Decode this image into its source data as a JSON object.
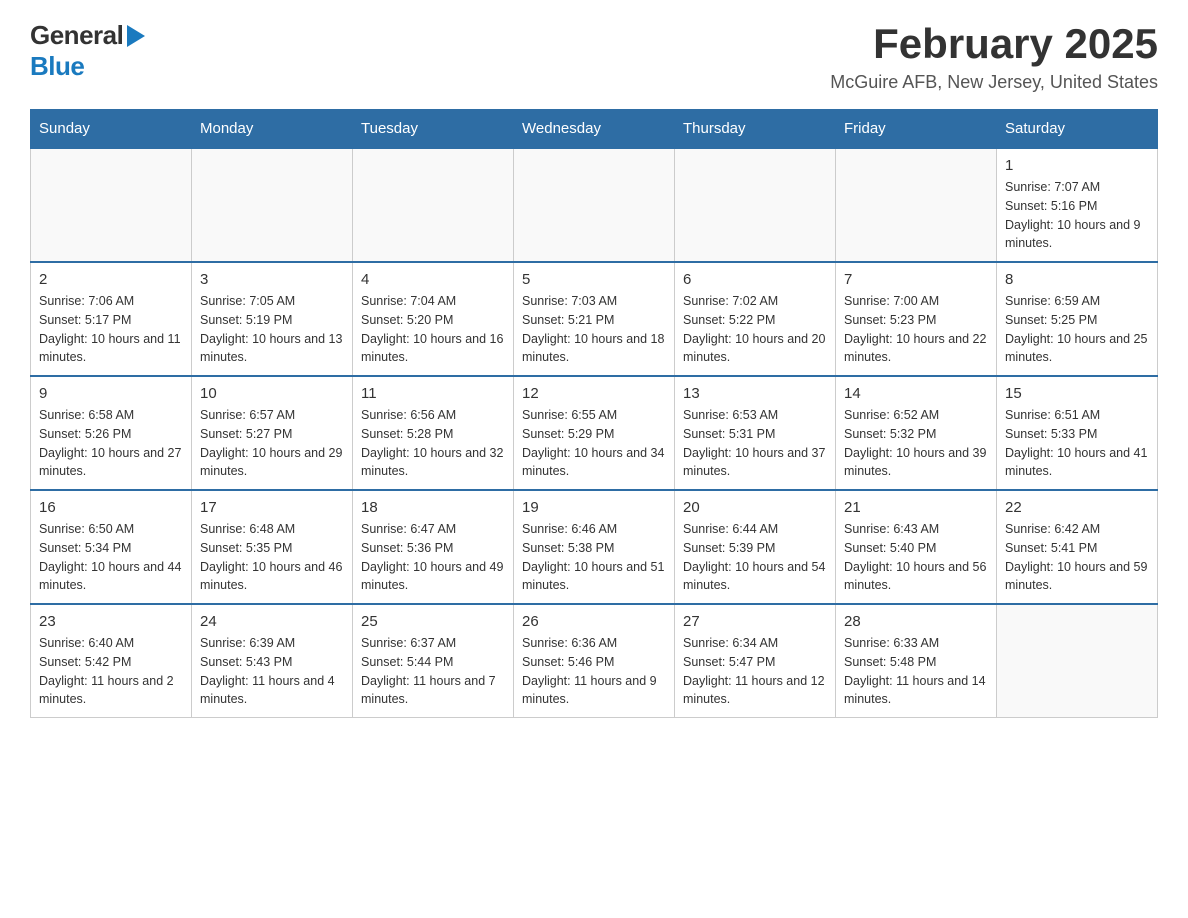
{
  "logo": {
    "word1": "General",
    "word2": "Blue"
  },
  "header": {
    "title": "February 2025",
    "subtitle": "McGuire AFB, New Jersey, United States"
  },
  "days_of_week": [
    "Sunday",
    "Monday",
    "Tuesday",
    "Wednesday",
    "Thursday",
    "Friday",
    "Saturday"
  ],
  "weeks": [
    {
      "days": [
        {
          "number": "",
          "info": "",
          "empty": true
        },
        {
          "number": "",
          "info": "",
          "empty": true
        },
        {
          "number": "",
          "info": "",
          "empty": true
        },
        {
          "number": "",
          "info": "",
          "empty": true
        },
        {
          "number": "",
          "info": "",
          "empty": true
        },
        {
          "number": "",
          "info": "",
          "empty": true
        },
        {
          "number": "1",
          "info": "Sunrise: 7:07 AM\nSunset: 5:16 PM\nDaylight: 10 hours and 9 minutes."
        }
      ]
    },
    {
      "days": [
        {
          "number": "2",
          "info": "Sunrise: 7:06 AM\nSunset: 5:17 PM\nDaylight: 10 hours and 11 minutes."
        },
        {
          "number": "3",
          "info": "Sunrise: 7:05 AM\nSunset: 5:19 PM\nDaylight: 10 hours and 13 minutes."
        },
        {
          "number": "4",
          "info": "Sunrise: 7:04 AM\nSunset: 5:20 PM\nDaylight: 10 hours and 16 minutes."
        },
        {
          "number": "5",
          "info": "Sunrise: 7:03 AM\nSunset: 5:21 PM\nDaylight: 10 hours and 18 minutes."
        },
        {
          "number": "6",
          "info": "Sunrise: 7:02 AM\nSunset: 5:22 PM\nDaylight: 10 hours and 20 minutes."
        },
        {
          "number": "7",
          "info": "Sunrise: 7:00 AM\nSunset: 5:23 PM\nDaylight: 10 hours and 22 minutes."
        },
        {
          "number": "8",
          "info": "Sunrise: 6:59 AM\nSunset: 5:25 PM\nDaylight: 10 hours and 25 minutes."
        }
      ]
    },
    {
      "days": [
        {
          "number": "9",
          "info": "Sunrise: 6:58 AM\nSunset: 5:26 PM\nDaylight: 10 hours and 27 minutes."
        },
        {
          "number": "10",
          "info": "Sunrise: 6:57 AM\nSunset: 5:27 PM\nDaylight: 10 hours and 29 minutes."
        },
        {
          "number": "11",
          "info": "Sunrise: 6:56 AM\nSunset: 5:28 PM\nDaylight: 10 hours and 32 minutes."
        },
        {
          "number": "12",
          "info": "Sunrise: 6:55 AM\nSunset: 5:29 PM\nDaylight: 10 hours and 34 minutes."
        },
        {
          "number": "13",
          "info": "Sunrise: 6:53 AM\nSunset: 5:31 PM\nDaylight: 10 hours and 37 minutes."
        },
        {
          "number": "14",
          "info": "Sunrise: 6:52 AM\nSunset: 5:32 PM\nDaylight: 10 hours and 39 minutes."
        },
        {
          "number": "15",
          "info": "Sunrise: 6:51 AM\nSunset: 5:33 PM\nDaylight: 10 hours and 41 minutes."
        }
      ]
    },
    {
      "days": [
        {
          "number": "16",
          "info": "Sunrise: 6:50 AM\nSunset: 5:34 PM\nDaylight: 10 hours and 44 minutes."
        },
        {
          "number": "17",
          "info": "Sunrise: 6:48 AM\nSunset: 5:35 PM\nDaylight: 10 hours and 46 minutes."
        },
        {
          "number": "18",
          "info": "Sunrise: 6:47 AM\nSunset: 5:36 PM\nDaylight: 10 hours and 49 minutes."
        },
        {
          "number": "19",
          "info": "Sunrise: 6:46 AM\nSunset: 5:38 PM\nDaylight: 10 hours and 51 minutes."
        },
        {
          "number": "20",
          "info": "Sunrise: 6:44 AM\nSunset: 5:39 PM\nDaylight: 10 hours and 54 minutes."
        },
        {
          "number": "21",
          "info": "Sunrise: 6:43 AM\nSunset: 5:40 PM\nDaylight: 10 hours and 56 minutes."
        },
        {
          "number": "22",
          "info": "Sunrise: 6:42 AM\nSunset: 5:41 PM\nDaylight: 10 hours and 59 minutes."
        }
      ]
    },
    {
      "days": [
        {
          "number": "23",
          "info": "Sunrise: 6:40 AM\nSunset: 5:42 PM\nDaylight: 11 hours and 2 minutes."
        },
        {
          "number": "24",
          "info": "Sunrise: 6:39 AM\nSunset: 5:43 PM\nDaylight: 11 hours and 4 minutes."
        },
        {
          "number": "25",
          "info": "Sunrise: 6:37 AM\nSunset: 5:44 PM\nDaylight: 11 hours and 7 minutes."
        },
        {
          "number": "26",
          "info": "Sunrise: 6:36 AM\nSunset: 5:46 PM\nDaylight: 11 hours and 9 minutes."
        },
        {
          "number": "27",
          "info": "Sunrise: 6:34 AM\nSunset: 5:47 PM\nDaylight: 11 hours and 12 minutes."
        },
        {
          "number": "28",
          "info": "Sunrise: 6:33 AM\nSunset: 5:48 PM\nDaylight: 11 hours and 14 minutes."
        },
        {
          "number": "",
          "info": "",
          "empty": true
        }
      ]
    }
  ],
  "colors": {
    "header_bg": "#2e6da4",
    "header_text": "#ffffff",
    "border": "#cccccc",
    "logo_blue": "#1a7abf",
    "text": "#333333"
  }
}
